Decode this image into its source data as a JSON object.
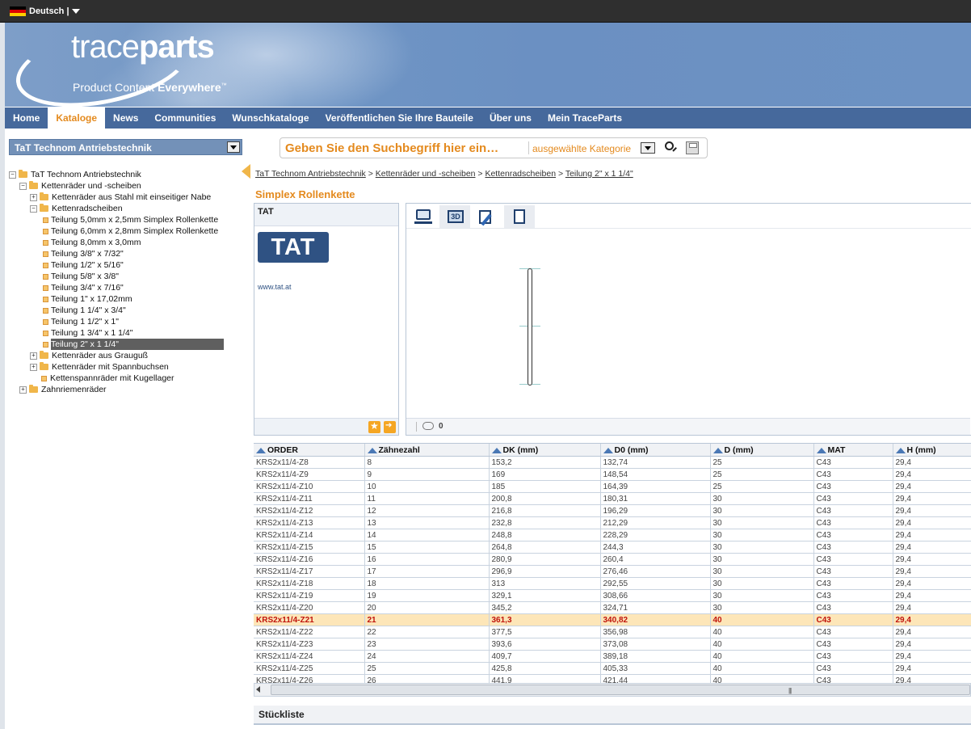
{
  "language": {
    "label": "Deutsch |"
  },
  "brand": {
    "logo_light": "trace",
    "logo_bold": "parts",
    "tagline_light": "Product Content ",
    "tagline_bold": "Everywhere",
    "tagline_tm": "™"
  },
  "nav": {
    "items": [
      "Home",
      "Kataloge",
      "News",
      "Communities",
      "Wunschkataloge",
      "Veröffentlichen Sie Ihre Bauteile",
      "Über uns",
      "Mein TraceParts"
    ],
    "active": "Kataloge"
  },
  "catalog_select": {
    "value": "TaT Technom Antriebstechnik"
  },
  "search": {
    "placeholder": "Geben Sie den Suchbegriff hier ein…",
    "category": "ausgewählte Kategorie"
  },
  "tree": [
    {
      "label": "TaT Technom Antriebstechnik",
      "level": 0,
      "toggle": "−",
      "icon": "folder"
    },
    {
      "label": "Kettenräder und -scheiben",
      "level": 1,
      "toggle": "−",
      "icon": "folder"
    },
    {
      "label": "Kettenräder aus Stahl mit einseitiger Nabe",
      "level": 2,
      "toggle": "+",
      "icon": "folder"
    },
    {
      "label": "Kettenradscheiben",
      "level": 2,
      "toggle": "−",
      "icon": "folder"
    },
    {
      "label": "Teilung 5,0mm x 2,5mm Simplex Rollenkette",
      "level": 3,
      "icon": "leaf"
    },
    {
      "label": "Teilung 6,0mm x 2,8mm Simplex Rollenkette",
      "level": 3,
      "icon": "leaf"
    },
    {
      "label": "Teilung 8,0mm x 3,0mm",
      "level": 3,
      "icon": "leaf"
    },
    {
      "label": "Teilung 3/8\" x 7/32\"",
      "level": 3,
      "icon": "leaf"
    },
    {
      "label": "Teilung 1/2\" x 5/16\"",
      "level": 3,
      "icon": "leaf"
    },
    {
      "label": "Teilung 5/8\" x 3/8\"",
      "level": 3,
      "icon": "leaf"
    },
    {
      "label": "Teilung 3/4\" x 7/16\"",
      "level": 3,
      "icon": "leaf"
    },
    {
      "label": "Teilung 1\" x 17,02mm",
      "level": 3,
      "icon": "leaf"
    },
    {
      "label": "Teilung 1 1/4\" x 3/4\"",
      "level": 3,
      "icon": "leaf"
    },
    {
      "label": "Teilung 1 1/2\" x 1\"",
      "level": 3,
      "icon": "leaf"
    },
    {
      "label": "Teilung 1 3/4\" x 1 1/4\"",
      "level": 3,
      "icon": "leaf"
    },
    {
      "label": "Teilung 2\" x 1 1/4\"",
      "level": 3,
      "icon": "leaf",
      "selected": true
    },
    {
      "label": "Kettenräder aus Grauguß",
      "level": 2,
      "toggle": "+",
      "icon": "folder"
    },
    {
      "label": "Kettenräder mit Spannbuchsen",
      "level": 2,
      "toggle": "+",
      "icon": "folder"
    },
    {
      "label": "Kettenspannräder mit Kugellager",
      "level": 2,
      "icon": "leaf"
    },
    {
      "label": "Zahnriemenräder",
      "level": 1,
      "toggle": "+",
      "icon": "folder"
    }
  ],
  "breadcrumb": [
    "TaT Technom Antriebstechnik",
    "Kettenräder und -scheiben",
    "Kettenradscheiben",
    "Teilung 2\" x 1 1/4\""
  ],
  "product_title": "Simplex Rollenkette",
  "supplier": {
    "name": "TAT",
    "logo_text": "TAT",
    "url": "www.tat.at"
  },
  "viewer": {
    "active_tool": "3d",
    "comment_count": "0"
  },
  "table": {
    "columns": [
      "ORDER",
      "Zähnezahl",
      "DK (mm)",
      "D0 (mm)",
      "D (mm)",
      "MAT",
      "H (mm)"
    ],
    "rows": [
      [
        "KRS2x11/4-Z8",
        "8",
        "153,2",
        "132,74",
        "25",
        "C43",
        "29,4"
      ],
      [
        "KRS2x11/4-Z9",
        "9",
        "169",
        "148,54",
        "25",
        "C43",
        "29,4"
      ],
      [
        "KRS2x11/4-Z10",
        "10",
        "185",
        "164,39",
        "25",
        "C43",
        "29,4"
      ],
      [
        "KRS2x11/4-Z11",
        "11",
        "200,8",
        "180,31",
        "30",
        "C43",
        "29,4"
      ],
      [
        "KRS2x11/4-Z12",
        "12",
        "216,8",
        "196,29",
        "30",
        "C43",
        "29,4"
      ],
      [
        "KRS2x11/4-Z13",
        "13",
        "232,8",
        "212,29",
        "30",
        "C43",
        "29,4"
      ],
      [
        "KRS2x11/4-Z14",
        "14",
        "248,8",
        "228,29",
        "30",
        "C43",
        "29,4"
      ],
      [
        "KRS2x11/4-Z15",
        "15",
        "264,8",
        "244,3",
        "30",
        "C43",
        "29,4"
      ],
      [
        "KRS2x11/4-Z16",
        "16",
        "280,9",
        "260,4",
        "30",
        "C43",
        "29,4"
      ],
      [
        "KRS2x11/4-Z17",
        "17",
        "296,9",
        "276,46",
        "30",
        "C43",
        "29,4"
      ],
      [
        "KRS2x11/4-Z18",
        "18",
        "313",
        "292,55",
        "30",
        "C43",
        "29,4"
      ],
      [
        "KRS2x11/4-Z19",
        "19",
        "329,1",
        "308,66",
        "30",
        "C43",
        "29,4"
      ],
      [
        "KRS2x11/4-Z20",
        "20",
        "345,2",
        "324,71",
        "30",
        "C43",
        "29,4"
      ],
      [
        "KRS2x11/4-Z21",
        "21",
        "361,3",
        "340,82",
        "40",
        "C43",
        "29,4"
      ],
      [
        "KRS2x11/4-Z22",
        "22",
        "377,5",
        "356,98",
        "40",
        "C43",
        "29,4"
      ],
      [
        "KRS2x11/4-Z23",
        "23",
        "393,6",
        "373,08",
        "40",
        "C43",
        "29,4"
      ],
      [
        "KRS2x11/4-Z24",
        "24",
        "409,7",
        "389,18",
        "40",
        "C43",
        "29,4"
      ],
      [
        "KRS2x11/4-Z25",
        "25",
        "425,8",
        "405,33",
        "40",
        "C43",
        "29,4"
      ],
      [
        "KRS2x11/4-Z26",
        "26",
        "441,9",
        "421,44",
        "40",
        "C43",
        "29,4"
      ]
    ],
    "selected_order": "KRS2x11/4-Z21"
  },
  "bom": {
    "title": "Stückliste"
  }
}
